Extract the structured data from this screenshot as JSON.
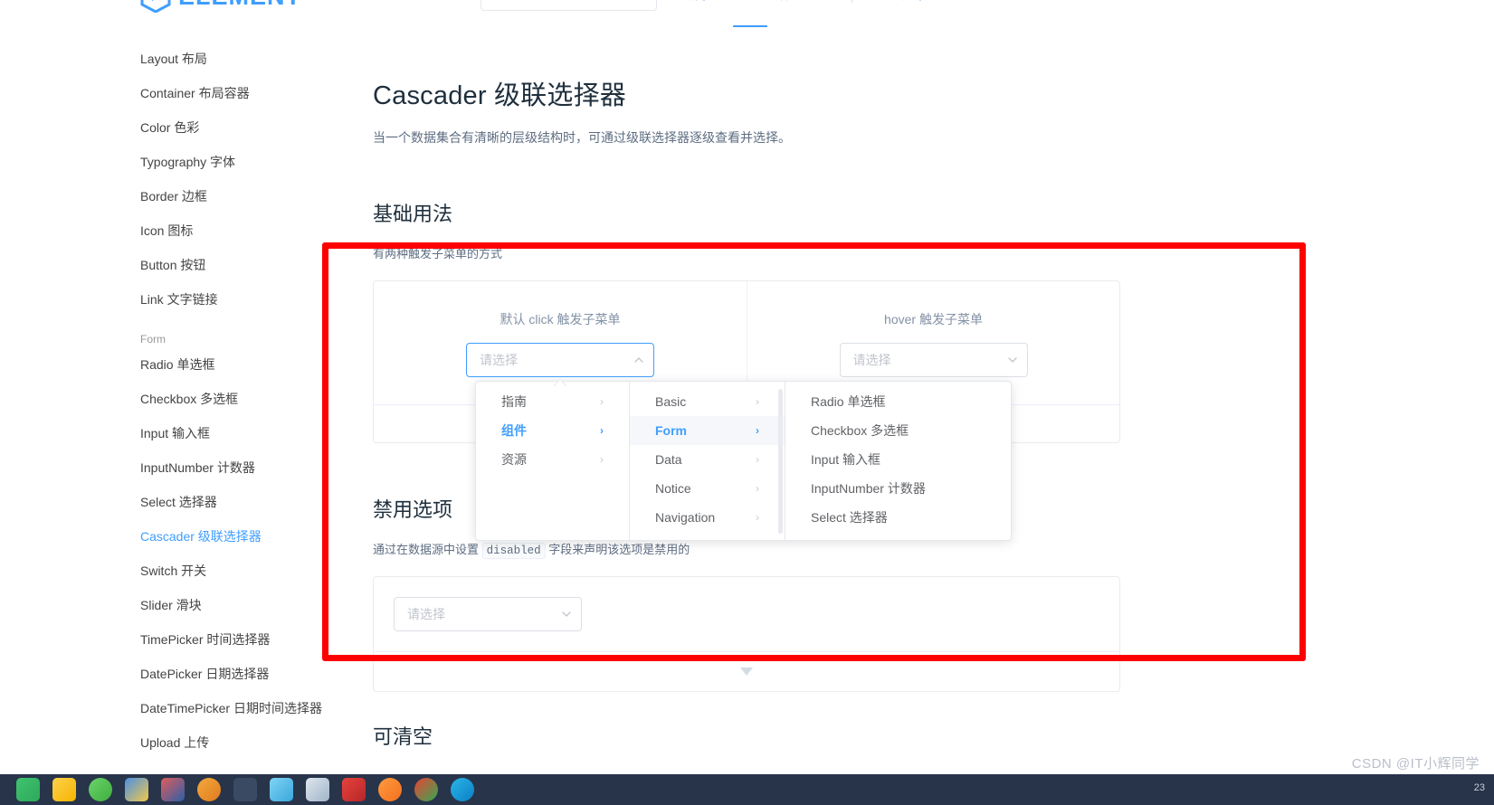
{
  "header": {
    "logo_text": "ELEMENT",
    "search_placeholder": "",
    "nav": [
      {
        "label": "指南",
        "caret": "▼"
      },
      {
        "label": "组件",
        "caret": "▼"
      },
      {
        "label": "资源",
        "caret": ""
      }
    ]
  },
  "sidebar": {
    "items": [
      {
        "label": "Layout 布局",
        "type": "item",
        "active": false
      },
      {
        "label": "Container 布局容器",
        "type": "item",
        "active": false
      },
      {
        "label": "Color 色彩",
        "type": "item",
        "active": false
      },
      {
        "label": "Typography 字体",
        "type": "item",
        "active": false
      },
      {
        "label": "Border 边框",
        "type": "item",
        "active": false
      },
      {
        "label": "Icon 图标",
        "type": "item",
        "active": false
      },
      {
        "label": "Button 按钮",
        "type": "item",
        "active": false
      },
      {
        "label": "Link 文字链接",
        "type": "item",
        "active": false
      },
      {
        "label": "Form",
        "type": "group",
        "active": false
      },
      {
        "label": "Radio 单选框",
        "type": "item",
        "active": false
      },
      {
        "label": "Checkbox 多选框",
        "type": "item",
        "active": false
      },
      {
        "label": "Input 输入框",
        "type": "item",
        "active": false
      },
      {
        "label": "InputNumber 计数器",
        "type": "item",
        "active": false
      },
      {
        "label": "Select 选择器",
        "type": "item",
        "active": false
      },
      {
        "label": "Cascader 级联选择器",
        "type": "item",
        "active": true
      },
      {
        "label": "Switch 开关",
        "type": "item",
        "active": false
      },
      {
        "label": "Slider 滑块",
        "type": "item",
        "active": false
      },
      {
        "label": "TimePicker 时间选择器",
        "type": "item",
        "active": false
      },
      {
        "label": "DatePicker 日期选择器",
        "type": "item",
        "active": false
      },
      {
        "label": "DateTimePicker 日期时间选择器",
        "type": "item",
        "active": false
      },
      {
        "label": "Upload 上传",
        "type": "item",
        "active": false
      }
    ]
  },
  "main": {
    "page_title": "Cascader 级联选择器",
    "page_desc": "当一个数据集合有清晰的层级结构时，可通过级联选择器逐级查看并选择。",
    "section_basic": {
      "title": "基础用法",
      "desc": "有两种触发子菜单的方式",
      "col_left_label": "默认 click 触发子菜单",
      "col_right_label": "hover 触发子菜单",
      "input_placeholder": "请选择"
    },
    "section_disabled": {
      "title": "禁用选项",
      "desc_before": "通过在数据源中设置 ",
      "desc_code": "disabled",
      "desc_after": " 字段来声明该选项是禁用的",
      "input_placeholder": "请选择"
    },
    "section_clearable": {
      "title": "可清空"
    }
  },
  "cascader_menu": {
    "column1": [
      {
        "label": "指南",
        "has_children": true,
        "active": false
      },
      {
        "label": "组件",
        "has_children": true,
        "active": true
      },
      {
        "label": "资源",
        "has_children": true,
        "active": false
      }
    ],
    "column2": [
      {
        "label": "Basic",
        "has_children": true,
        "active": false
      },
      {
        "label": "Form",
        "has_children": true,
        "active": true
      },
      {
        "label": "Data",
        "has_children": true,
        "active": false
      },
      {
        "label": "Notice",
        "has_children": true,
        "active": false
      },
      {
        "label": "Navigation",
        "has_children": true,
        "active": false
      }
    ],
    "column3": [
      {
        "label": "Radio 单选框",
        "has_children": false,
        "active": false
      },
      {
        "label": "Checkbox 多选框",
        "has_children": false,
        "active": false
      },
      {
        "label": "Input 输入框",
        "has_children": false,
        "active": false
      },
      {
        "label": "InputNumber 计数器",
        "has_children": false,
        "active": false
      },
      {
        "label": "Select 选择器",
        "has_children": false,
        "active": false
      }
    ],
    "chevron": "›"
  },
  "annotation": {
    "color": "#ff0000"
  },
  "watermark": {
    "text": "CSDN @IT小辉同学"
  },
  "taskbar": {
    "tray_text": "23"
  }
}
